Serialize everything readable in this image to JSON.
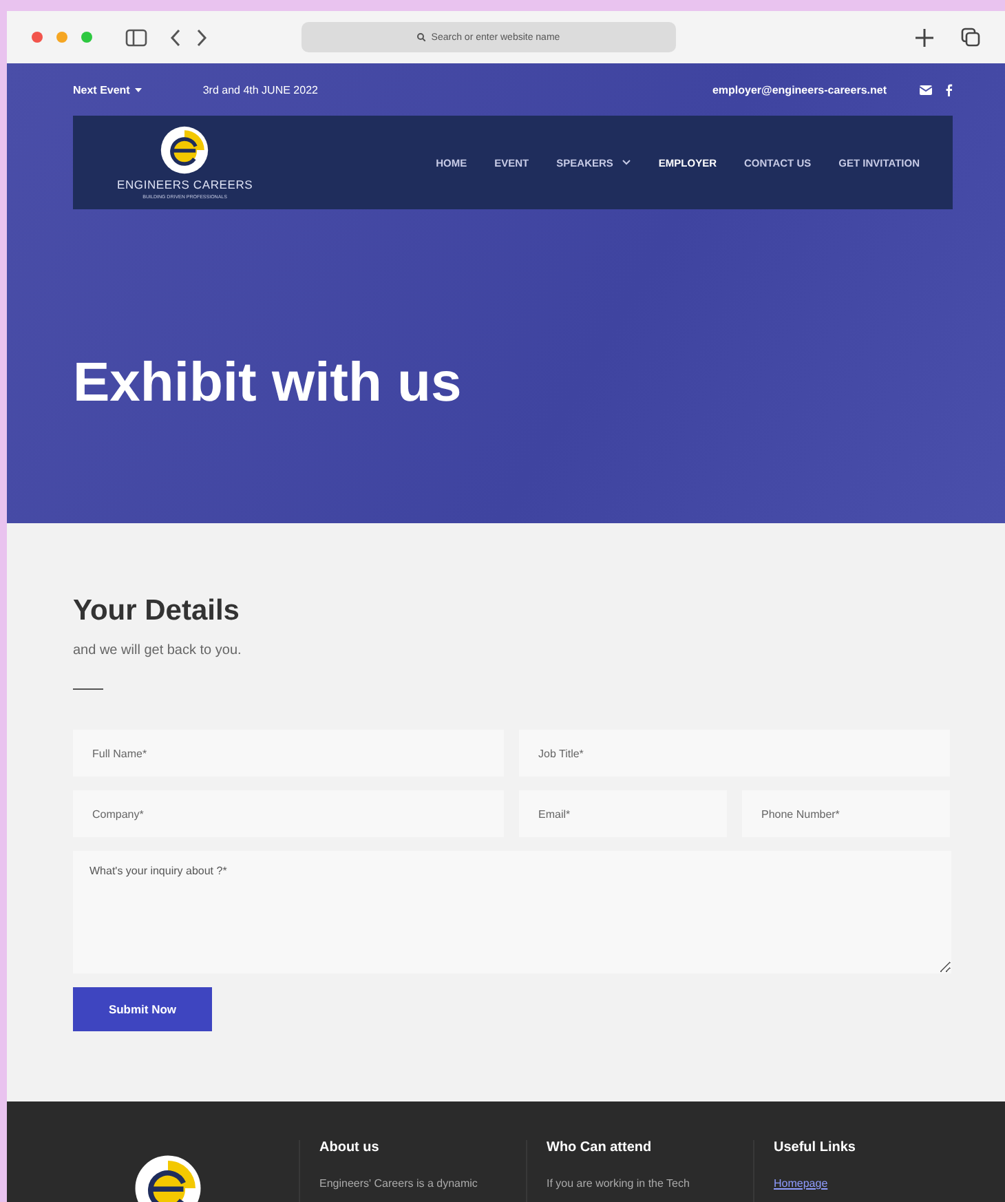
{
  "browser": {
    "address_placeholder": "Search or enter website name"
  },
  "top_bar": {
    "event_label": "Next Event",
    "event_date": "3rd and 4th JUNE 2022",
    "email": "employer@engineers-careers.net"
  },
  "logo": {
    "name": "ENGINEERS CAREERS",
    "tagline": "BUILDING DRIVEN PROFESSIONALS"
  },
  "nav": [
    {
      "label": "HOME",
      "selected": false,
      "has_menu": false
    },
    {
      "label": "EVENT",
      "selected": false,
      "has_menu": false
    },
    {
      "label": "SPEAKERS",
      "selected": false,
      "has_menu": true
    },
    {
      "label": "EMPLOYER",
      "selected": true,
      "has_menu": false
    },
    {
      "label": "CONTACT US",
      "selected": false,
      "has_menu": false
    },
    {
      "label": "GET INVITATION",
      "selected": false,
      "has_menu": false
    }
  ],
  "hero": {
    "title": "Exhibit with us"
  },
  "form": {
    "title": "Your Details",
    "subtitle": "and we will get back to you.",
    "rows": [
      [
        {
          "placeholder": "Full Name*"
        },
        {
          "placeholder": "Job Title*"
        }
      ],
      [
        {
          "placeholder": "Company*"
        },
        {
          "placeholder": "Email*"
        },
        {
          "placeholder": "Phone Number*"
        }
      ]
    ],
    "message": {
      "placeholder": "What's your inquiry about ?*"
    },
    "submit": "Submit Now"
  },
  "footer": {
    "columns": [
      {
        "title": "About us",
        "text": "Engineers' Careers is a dynamic",
        "kind": "text"
      },
      {
        "title": "Who Can attend",
        "text": "If you are working in the Tech",
        "kind": "text"
      },
      {
        "title": "Useful Links",
        "text": "Homepage",
        "kind": "link"
      }
    ]
  }
}
